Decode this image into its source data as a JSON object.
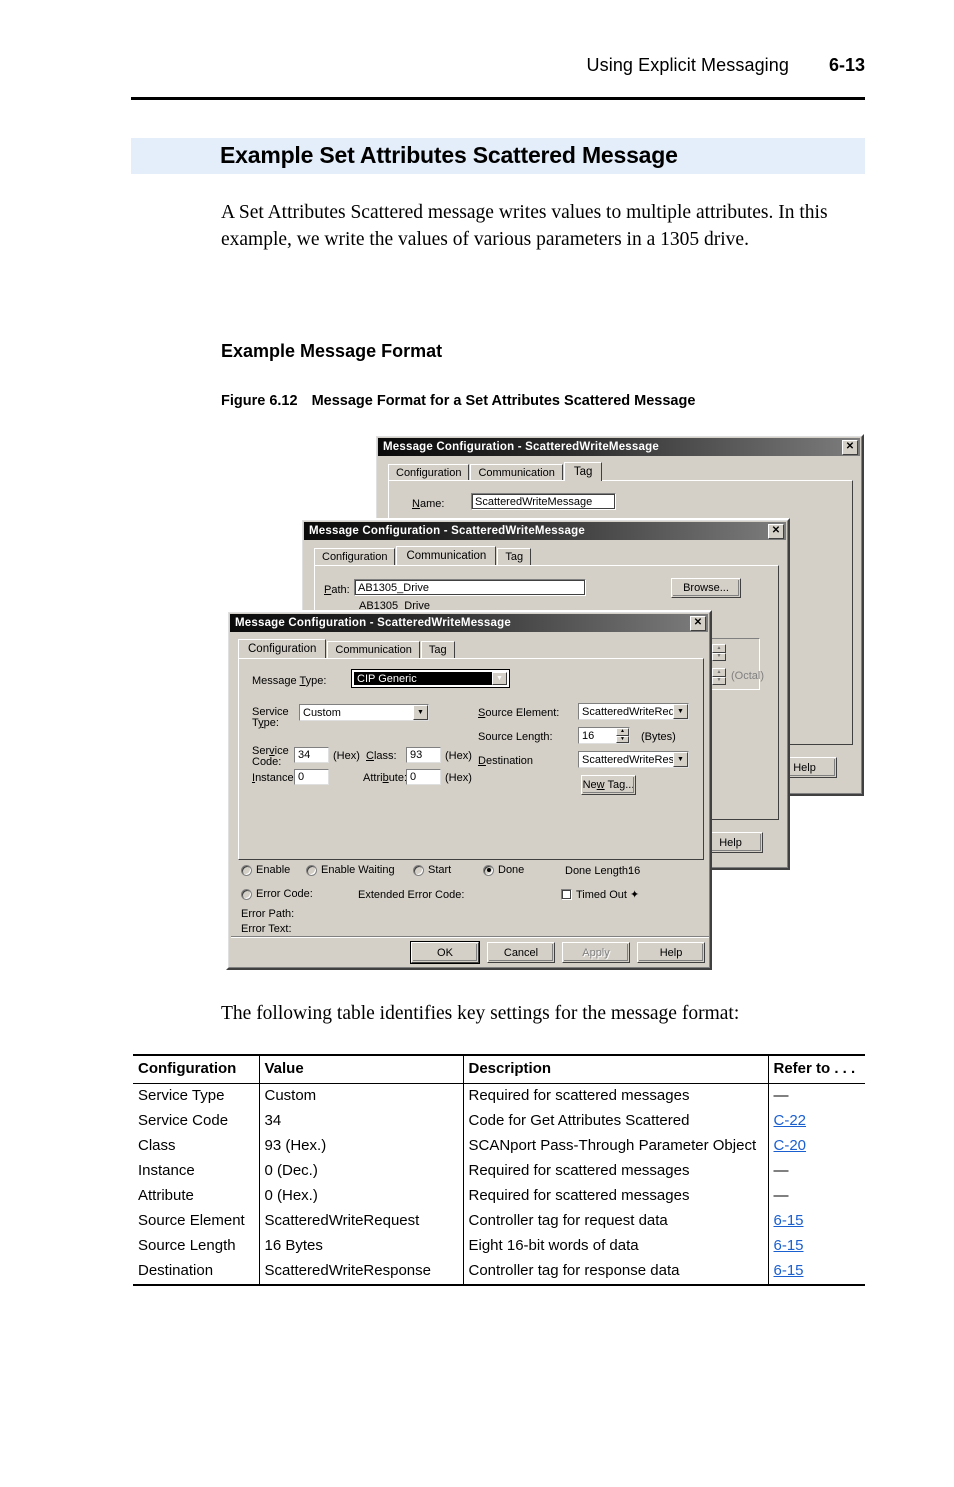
{
  "header": {
    "chapter_title": "Using Explicit Messaging",
    "page_number": "6-13"
  },
  "section": {
    "title": "Example Set Attributes Scattered Message",
    "intro_paragraph": "A Set Attributes Scattered message writes values to multiple attributes. In this example, we write the values of various parameters in a 1305 drive.",
    "subheading": "Example Message Format",
    "figure_number": "Figure 6.12",
    "figure_caption": "Message Format for a Set Attributes Scattered Message",
    "table_lead_in": "The following table identifies key settings for the message format:"
  },
  "dialog_tag": {
    "title": "Message Configuration - ScatteredWriteMessage",
    "close_label": "✕",
    "tabs": [
      {
        "label": "Configuration",
        "active": false
      },
      {
        "label": "Communication",
        "active": false
      },
      {
        "label": "Tag",
        "active": true
      }
    ],
    "name_label": "Name:",
    "name_value": "ScatteredWriteMessage",
    "help_label": "Help"
  },
  "dialog_comm": {
    "title": "Message Configuration - ScatteredWriteMessage",
    "close_label": "✕",
    "tabs": [
      {
        "label": "Configuration",
        "active": false
      },
      {
        "label": "Communication",
        "active": true
      },
      {
        "label": "Tag",
        "active": false
      }
    ],
    "path_label": "Path:",
    "path_value": "AB1305_Drive",
    "path_tree_value": "AB1305_Drive",
    "browse_label": "Browse...",
    "octal_label": "(Octal)",
    "help_label": "Help"
  },
  "dialog_config": {
    "title": "Message Configuration - ScatteredWriteMessage",
    "close_label": "✕",
    "tabs": [
      {
        "label": "Configuration",
        "active": true
      },
      {
        "label": "Communication",
        "active": false
      },
      {
        "label": "Tag",
        "active": false
      }
    ],
    "message_type_label": "Message Type:",
    "message_type_value": "CIP Generic",
    "service_type_label_line1": "Service",
    "service_type_label_line2": "Type:",
    "service_type_value": "Custom",
    "service_code_label_line1": "Service",
    "service_code_label_line2": "Code:",
    "service_code_value": "34",
    "service_code_unit": "(Hex)",
    "class_label": "Class:",
    "class_value": "93",
    "class_unit": "(Hex)",
    "instance_label": "Instance:",
    "instance_value": "0",
    "attribute_label": "Attribute:",
    "attribute_value": "0",
    "attribute_unit": "(Hex)",
    "source_element_label": "Source Element:",
    "source_element_value": "ScatteredWriteReque",
    "source_length_label": "Source Length:",
    "source_length_value": "16",
    "source_length_unit": "(Bytes)",
    "destination_label": "Destination",
    "destination_value": "ScatteredWriteRespo",
    "new_tag_label": "New Tag...",
    "status": {
      "enable_label": "Enable",
      "enable_waiting_label": "Enable Waiting",
      "start_label": "Start",
      "done_label": "Done",
      "done_selected": true,
      "done_length_label": "Done Length:",
      "done_length_value": "16",
      "error_code_label": "Error Code:",
      "extended_error_code_label": "Extended Error Code:",
      "timed_out_label": "Timed Out ✦",
      "error_path_label": "Error Path:",
      "error_text_label": "Error Text:"
    },
    "buttons": {
      "ok": "OK",
      "cancel": "Cancel",
      "apply": "Apply",
      "help": "Help"
    }
  },
  "table": {
    "columns": [
      "Configuration",
      "Value",
      "Description",
      "Refer to . . ."
    ],
    "rows": [
      {
        "configuration": "Service Type",
        "value": "Custom",
        "description": "Required for scattered messages",
        "refer_to": "—",
        "refer_link": false
      },
      {
        "configuration": "Service Code",
        "value": "34",
        "description": "Code for Get Attributes Scattered",
        "refer_to": "C-22",
        "refer_link": true
      },
      {
        "configuration": "Class",
        "value": "93 (Hex.)",
        "description": "SCANport Pass-Through Parameter Object",
        "refer_to": "C-20",
        "refer_link": true
      },
      {
        "configuration": "Instance",
        "value": "0 (Dec.)",
        "description": "Required for scattered messages",
        "refer_to": "—",
        "refer_link": false
      },
      {
        "configuration": "Attribute",
        "value": "0 (Hex.)",
        "description": "Required for scattered messages",
        "refer_to": "—",
        "refer_link": false
      },
      {
        "configuration": "Source Element",
        "value": "ScatteredWriteRequest",
        "description": "Controller tag for request data",
        "refer_to": "6-15",
        "refer_link": true
      },
      {
        "configuration": "Source Length",
        "value": "16 Bytes",
        "description": "Eight 16-bit words of data",
        "refer_to": "6-15",
        "refer_link": true
      },
      {
        "configuration": "Destination",
        "value": "ScatteredWriteResponse",
        "description": "Controller tag for response data",
        "refer_to": "6-15",
        "refer_link": true
      }
    ]
  },
  "colors": {
    "banner": "#e4eefb",
    "link": "#1a5fd0",
    "dialog_face": "#d4d0c8"
  }
}
